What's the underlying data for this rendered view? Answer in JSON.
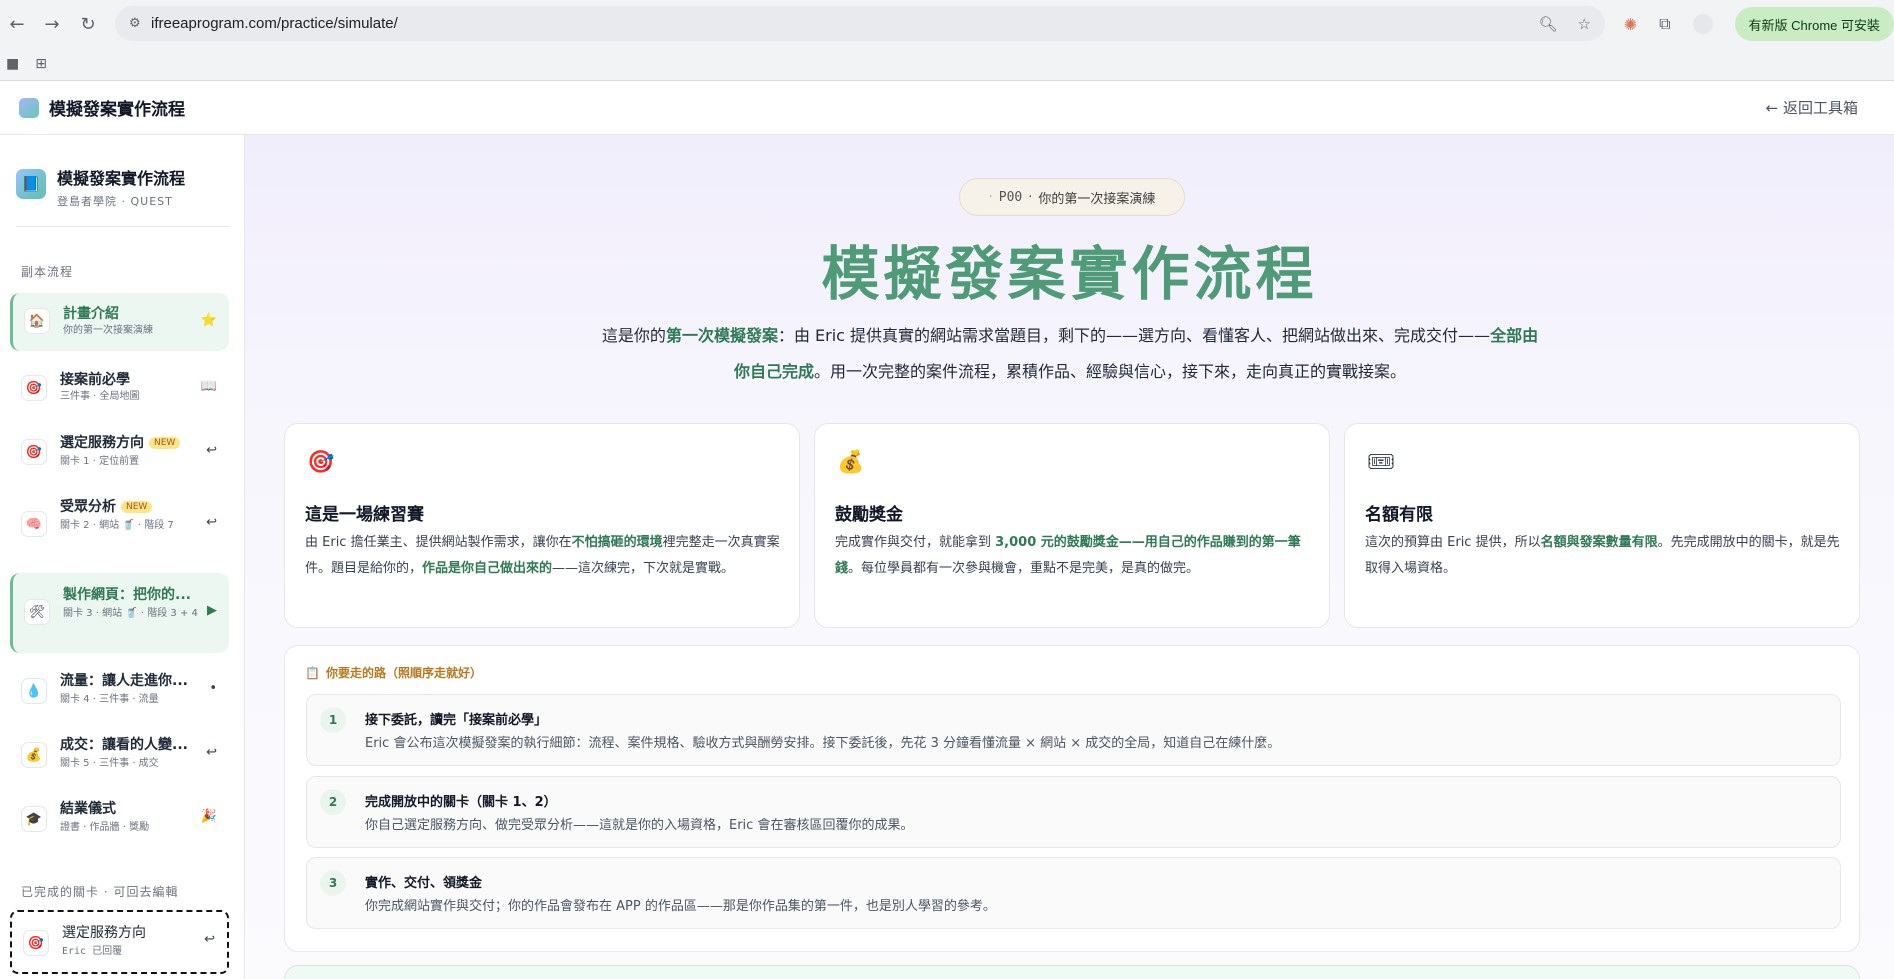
{
  "browser": {
    "url": "ifreeaprogram.com/practice/simulate/",
    "update_label": "有新版 Chrome 可安裝"
  },
  "header": {
    "title": "模擬發案實作流程",
    "back_label": "← 返回工具箱"
  },
  "sidebar": {
    "title": "模擬發案實作流程",
    "subtitle": "登島者學院 · QUEST",
    "section_label": "副本流程",
    "items": [
      {
        "title": "計畫介紹",
        "sub": "你的第一次接案演練",
        "icon": "🏠",
        "mark": "⭐"
      },
      {
        "title": "接案前必學",
        "sub": "三件事 · 全局地圖",
        "icon": "🎯",
        "mark": "📖"
      },
      {
        "title": "選定服務方向",
        "badge": "NEW",
        "sub": "關卡 1 · 定位前置",
        "icon": "🎯",
        "mark": "↩"
      },
      {
        "title": "受眾分析",
        "badge": "NEW",
        "sub": "關卡 2 · 網站 🥤 · 階段 7",
        "icon": "🧠",
        "mark": "↩"
      },
      {
        "title": "製作網頁：把你的...",
        "sub": "關卡 3 · 網站 🥤 · 階段 3 + 4",
        "icon": "🛠",
        "mark": "▶"
      },
      {
        "title": "流量：讓人走進你...",
        "sub": "關卡 4 · 三件事 · 流量",
        "icon": "💧",
        "mark": "•"
      },
      {
        "title": "成交：讓看的人變...",
        "sub": "關卡 5 · 三件事 · 成交",
        "icon": "💰",
        "mark": "↩"
      },
      {
        "title": "結業儀式",
        "sub": "證書 · 作品牆 · 獎勵",
        "icon": "🎓",
        "mark": "🎉"
      }
    ],
    "done_section_label": "已完成的關卡 · 可回去編輯",
    "done_item": {
      "title": "選定服務方向",
      "sub": "Eric 已回覆",
      "icon": "🎯",
      "mark": "↩"
    }
  },
  "hero": {
    "pill_code": "P00",
    "pill_dot": "·",
    "pill_label": "你的第一次接案演練",
    "title": "模擬發案實作流程",
    "desc_1": "這是你的",
    "desc_hl1": "第一次模擬發案",
    "desc_2": "：由 Eric 提供真實的網站需求當題目，剩下的——選方向、看懂客人、把網站做出來、完成交付——",
    "desc_hl2": "全部由你自己完成",
    "desc_3": "。用一次完整的案件流程，累積作品、經驗與信心，接下來，走向真正的實戰接案。"
  },
  "cards": [
    {
      "icon": "🎯",
      "title": "這是一場練習賽",
      "p1": "由 Eric 擔任業主、提供網站製作需求，讓你在",
      "h1": "不怕搞砸的環境",
      "p2": "裡完整走一次真實案件。題目是給你的，",
      "h2": "作品是你自己做出來的",
      "p3": "——這次練完，下次就是實戰。"
    },
    {
      "icon": "💰",
      "title": "鼓勵獎金",
      "p1": "完成實作與交付，就能拿到 ",
      "h1": "3,000 元的鼓勵獎金——用自己的作品賺到的第一筆錢",
      "p2": "。每位學員都有一次參與機會，重點不是完美，是真的做完。",
      "h2": "",
      "p3": ""
    },
    {
      "icon": "🎟",
      "title": "名額有限",
      "p1": "這次的預算由 Eric 提供，所以",
      "h1": "名額與發案數量有限",
      "p2": "。先完成開放中的關卡，就是先取得入場資格。",
      "h2": "",
      "p3": ""
    }
  ],
  "path": {
    "icon": "📋",
    "heading": "你要走的路（照順序走就好）",
    "steps": [
      {
        "num": "1",
        "title": "接下委託，讀完「接案前必學」",
        "desc": "Eric 會公布這次模擬發案的執行細節：流程、案件規格、驗收方式與酬勞安排。接下委託後，先花 3 分鐘看懂流量 × 網站 × 成交的全局，知道自己在練什麼。"
      },
      {
        "num": "2",
        "title": "完成開放中的關卡（關卡 1、2）",
        "desc": "你自己選定服務方向、做完受眾分析——這就是你的入場資格，Eric 會在審核區回覆你的成果。"
      },
      {
        "num": "3",
        "title": "實作、交付、領獎金",
        "desc": "你完成網站實作與交付；你的作品會發布在 APP 的作品區——那是你作品集的第一件，也是別人學習的參考。"
      }
    ]
  },
  "colors": {
    "accent": "#4f9a77",
    "highlight": "#2f7a55",
    "badge": "#fde68a"
  }
}
